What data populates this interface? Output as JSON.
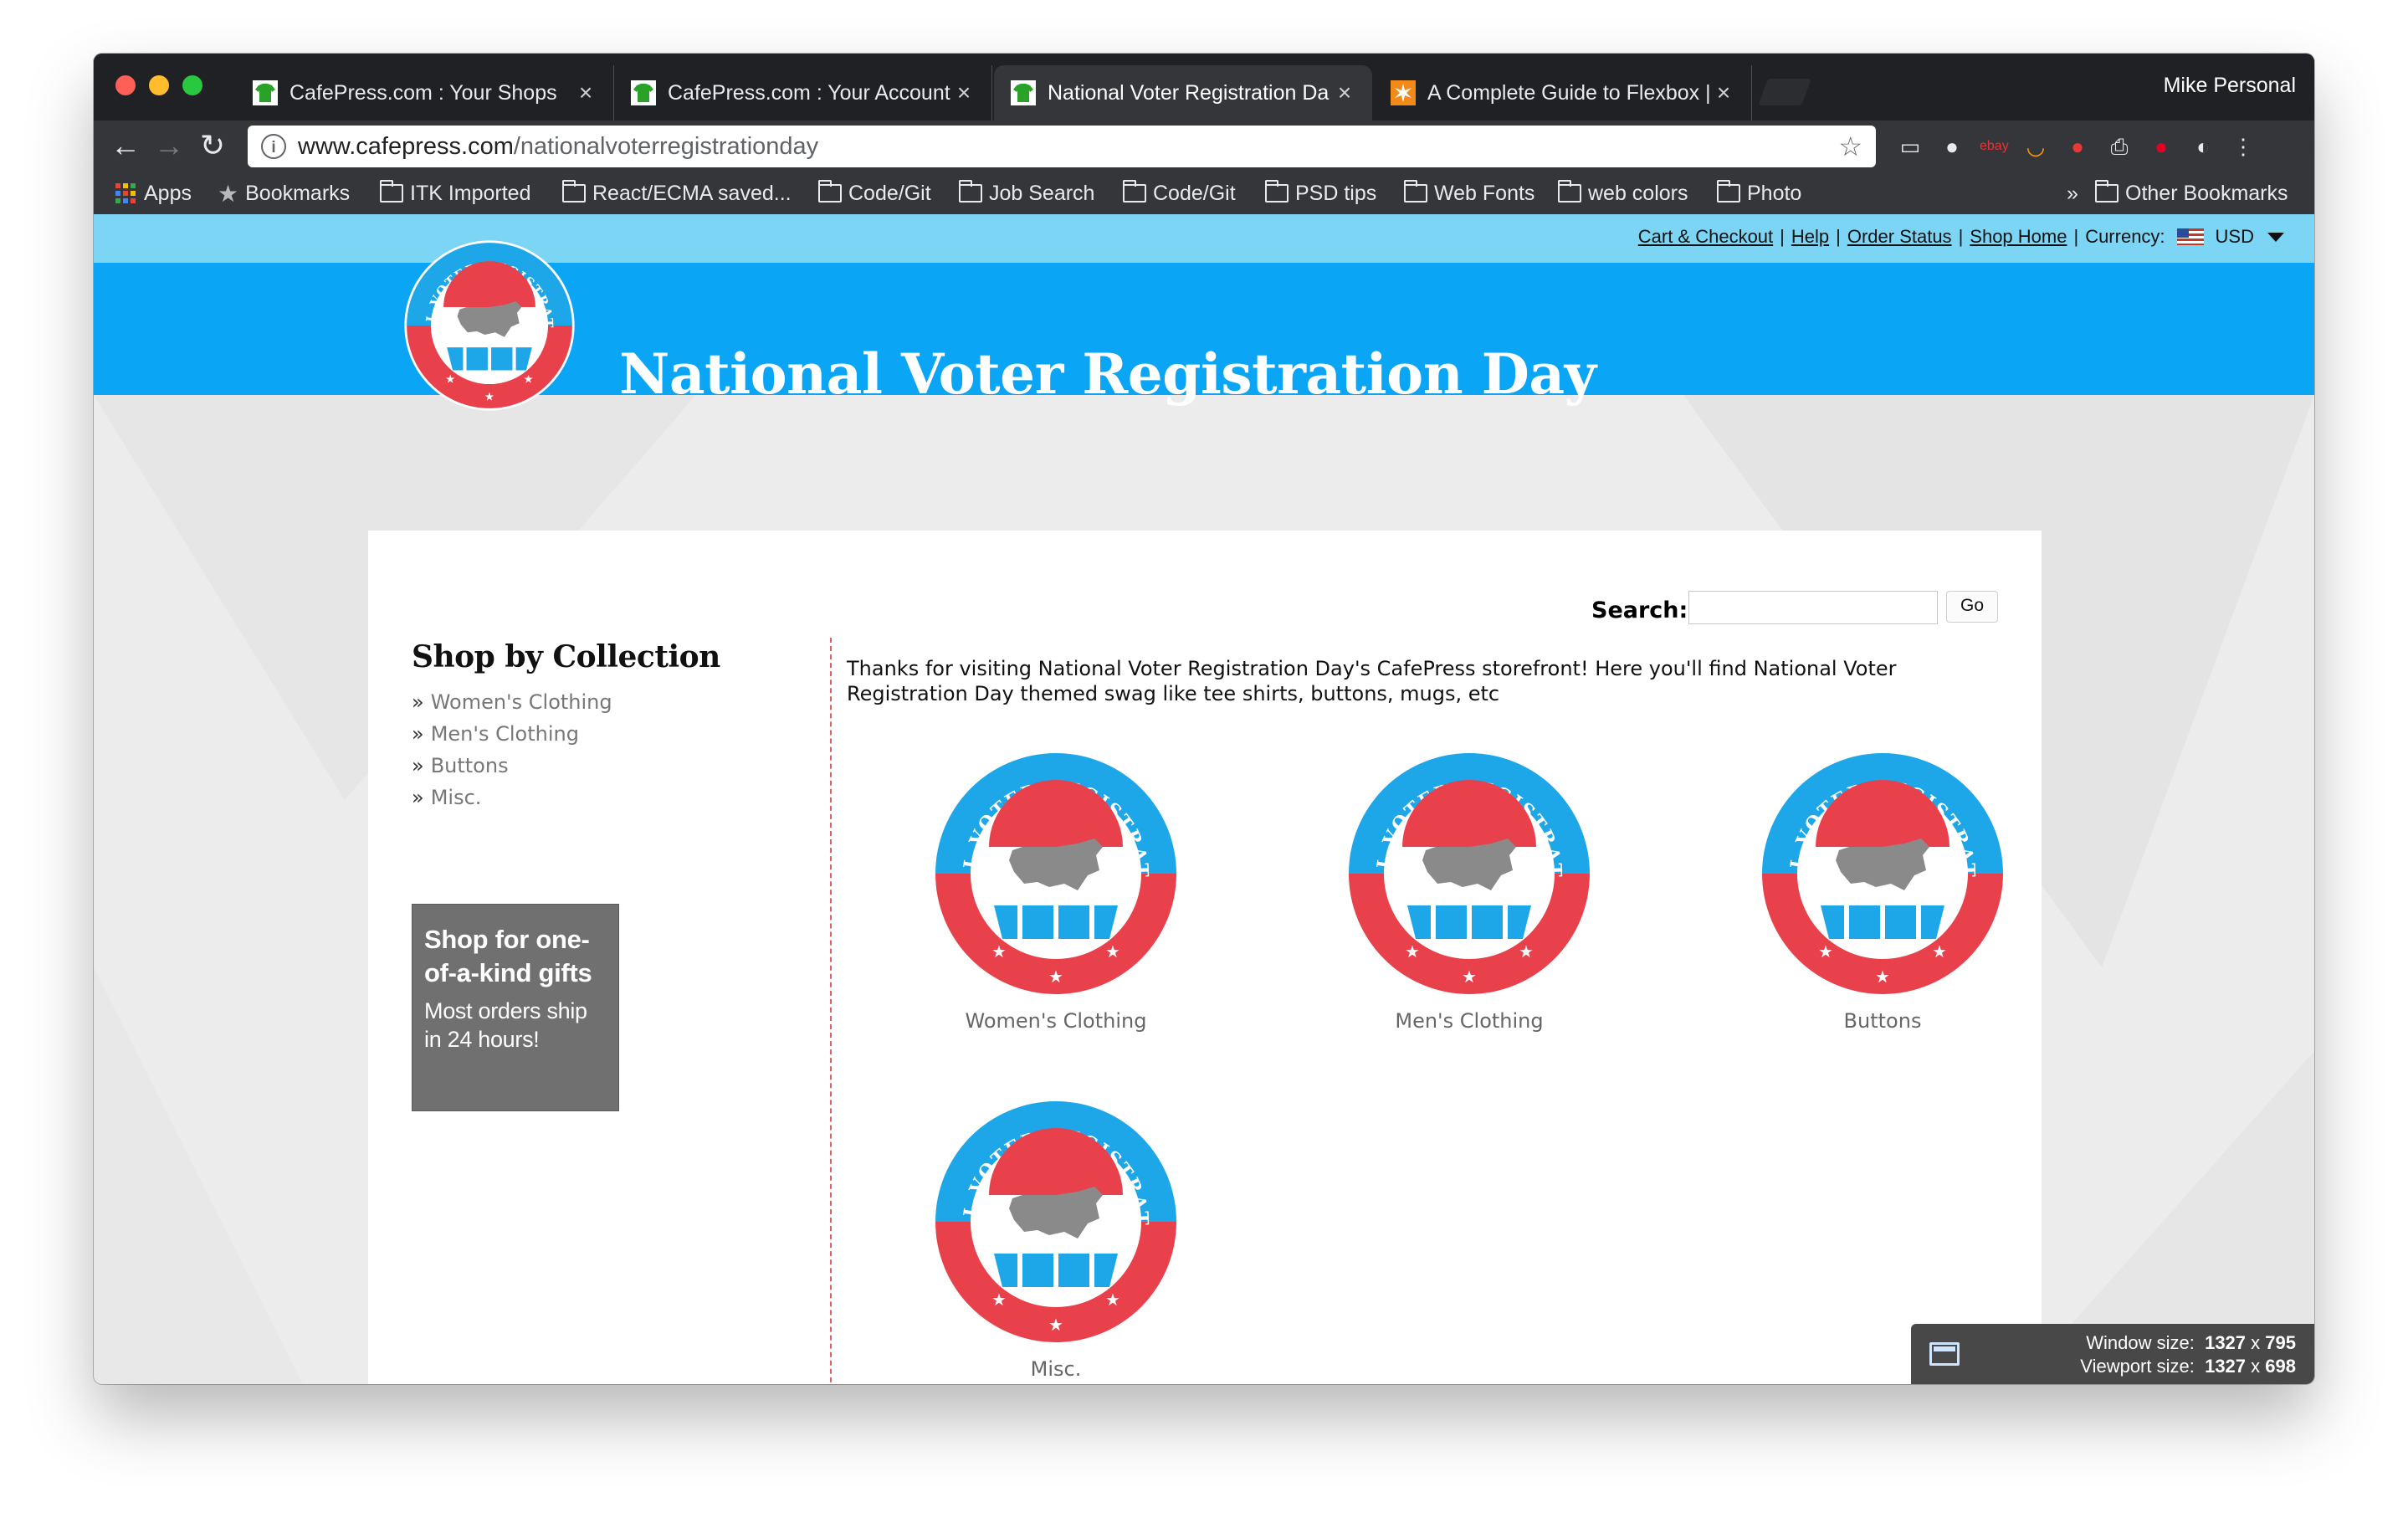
{
  "browser": {
    "tabs": [
      {
        "title": "CafePress.com : Your Shops",
        "favicon": "cafepress-shirt-icon",
        "active": false
      },
      {
        "title": "CafePress.com : Your Account",
        "favicon": "cafepress-shirt-icon",
        "active": false
      },
      {
        "title": "National Voter Registration Da",
        "favicon": "cafepress-shirt-icon",
        "active": true
      },
      {
        "title": "A Complete Guide to Flexbox |",
        "favicon": "css-tricks-star-icon",
        "active": false
      }
    ],
    "tab_close": "×",
    "profile": "Mike Personal",
    "url_domain": "www.cafepress.com",
    "url_path": "/nationalvoterregistrationday",
    "bookmarks": [
      {
        "label": "Apps",
        "icon": "apps-grid-icon"
      },
      {
        "label": "Bookmarks",
        "icon": "star-icon"
      },
      {
        "label": "ITK Imported",
        "icon": "folder-icon"
      },
      {
        "label": "React/ECMA saved...",
        "icon": "folder-icon"
      },
      {
        "label": "Code/Git",
        "icon": "folder-icon"
      },
      {
        "label": "Job Search",
        "icon": "folder-icon"
      },
      {
        "label": "Code/Git",
        "icon": "folder-icon"
      },
      {
        "label": "PSD tips",
        "icon": "folder-icon"
      },
      {
        "label": "Web Fonts",
        "icon": "folder-icon"
      },
      {
        "label": "web colors",
        "icon": "folder-icon"
      },
      {
        "label": "Photo",
        "icon": "folder-icon"
      }
    ],
    "more_bookmarks": "»",
    "other_bookmarks": "Other Bookmarks"
  },
  "site": {
    "top_links": [
      "Cart & Checkout",
      "Help",
      "Order Status",
      "Shop Home"
    ],
    "currency_label": "Currency:",
    "currency_value": "USD",
    "banner_title": "National Voter Registration Day",
    "logo_text_top": "NATIONAL VOTER REGISTRATION DAY",
    "search": {
      "label": "Search:",
      "value": "",
      "button": "Go"
    },
    "collection": {
      "title": "Shop by Collection",
      "bullet": "»",
      "items": [
        "Women's Clothing",
        "Men's Clothing",
        "Buttons",
        "Misc."
      ]
    },
    "promo": {
      "headline": "Shop for one-of-a-kind gifts",
      "sub": "Most orders ship in 24 hours!"
    },
    "intro": "Thanks for visiting National Voter Registration Day's CafePress storefront! Here you'll find National Voter Registration Day themed swag like tee shirts, buttons, mugs, etc",
    "products": [
      "Women's Clothing",
      "Men's Clothing",
      "Buttons",
      "Misc."
    ]
  },
  "devtools": {
    "window_label": "Window size:",
    "window_w": "1327",
    "window_h": "795",
    "viewport_label": "Viewport size:",
    "viewport_w": "1327",
    "viewport_h": "698",
    "times": "x"
  },
  "colors": {
    "banner": "#0aa5f4",
    "topbar": "#7dd5f5",
    "logo_blue": "#1ea7e8",
    "logo_red": "#e8414c",
    "divider": "#e06060"
  }
}
